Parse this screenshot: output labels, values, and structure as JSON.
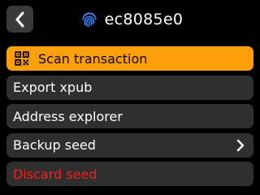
{
  "header": {
    "back_icon": "chevron-left-icon",
    "title_icon": "fingerprint-icon",
    "title": "ec8085e0",
    "title_icon_color": "#3b82f6"
  },
  "menu": {
    "items": [
      {
        "label": "Scan transaction",
        "icon": "qr-code-icon",
        "state": "selected",
        "color": "#ff9f0a"
      },
      {
        "label": "Export xpub"
      },
      {
        "label": "Address explorer"
      },
      {
        "label": "Backup seed",
        "trailing_icon": "chevron-right-icon"
      },
      {
        "label": "Discard seed",
        "style": "destructive",
        "color": "#ff1a1a"
      }
    ]
  }
}
